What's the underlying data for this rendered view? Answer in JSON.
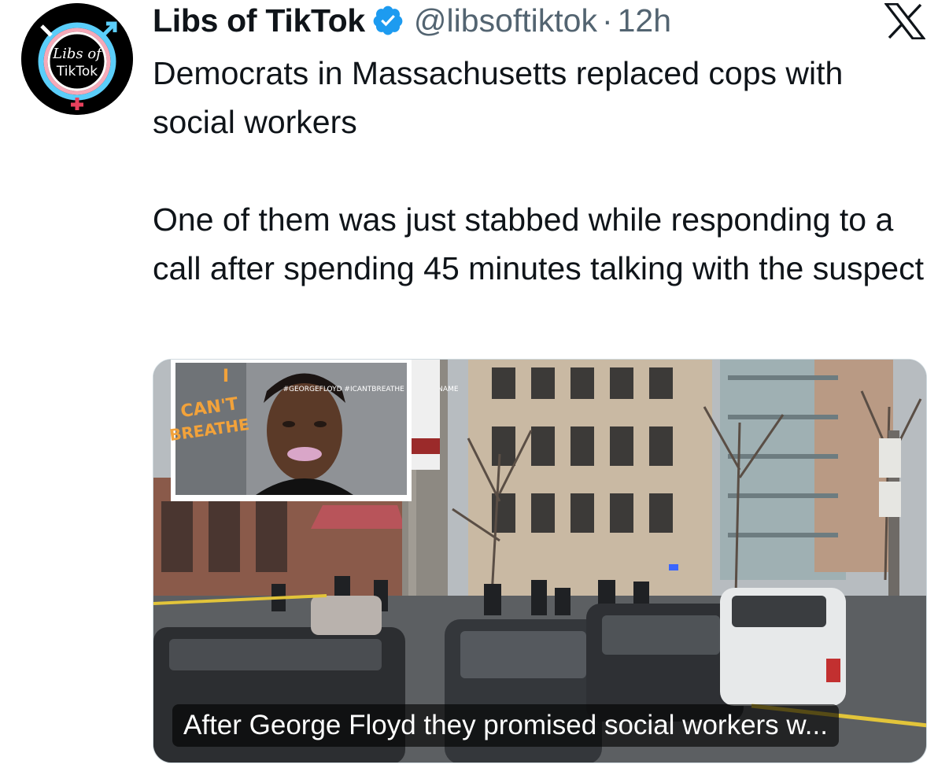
{
  "author": {
    "display_name": "Libs of TikTok",
    "handle": "@libsoftiktok",
    "separator": "·",
    "time": "12h",
    "avatar_text_line1": "Libs of",
    "avatar_text_line2": "TikTok",
    "verified_color": "#1d9bf0"
  },
  "tweet": {
    "paragraph1": "Democrats in Massachusetts replaced cops with social workers",
    "paragraph2": "One of them was just stabbed while responding to a call after spending 45 minutes talking with the suspect"
  },
  "media": {
    "caption": "After George Floyd they promised social workers w...",
    "inset_text_1": "I",
    "inset_text_2": "CAN'T",
    "inset_text_3": "BREATHE",
    "inset_hashtags": "#GEORGEFLOYD #ICANTBREATHE #SAYHISNAME"
  },
  "icons": {
    "platform_logo": "x-logo-icon",
    "verified": "verified-badge-icon"
  }
}
